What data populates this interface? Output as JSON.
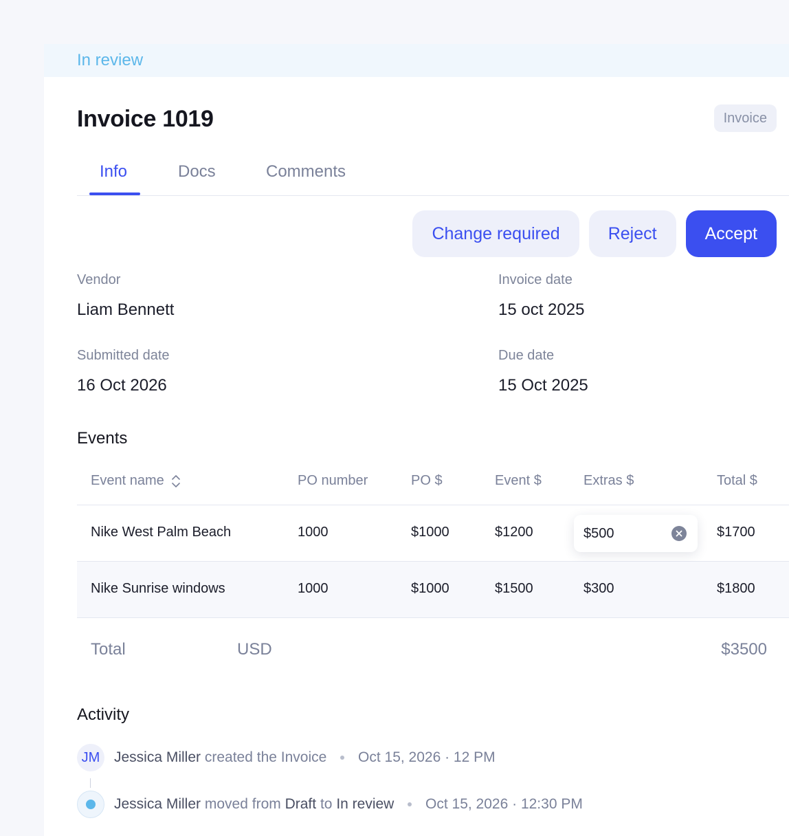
{
  "status": "In review",
  "header": {
    "title": "Invoice 1019",
    "badge": "Invoice"
  },
  "tabs": [
    {
      "label": "Info",
      "active": true
    },
    {
      "label": "Docs",
      "active": false
    },
    {
      "label": "Comments",
      "active": false
    }
  ],
  "actions": {
    "change_required": "Change required",
    "reject": "Reject",
    "accept": "Accept"
  },
  "fields": {
    "vendor": {
      "label": "Vendor",
      "value": "Liam Bennett"
    },
    "invoice_date": {
      "label": "Invoice date",
      "value": "15 oct 2025"
    },
    "submitted_date": {
      "label": "Submitted date",
      "value": "16 Oct 2026"
    },
    "due_date": {
      "label": "Due date",
      "value": "15 Oct 2025"
    }
  },
  "events": {
    "title": "Events",
    "columns": [
      "Event name",
      "PO number",
      "PO $",
      "Event $",
      "Extras $",
      "Total $"
    ],
    "rows": [
      {
        "name": "Nike West Palm Beach",
        "po_number": "1000",
        "po": "$1000",
        "event": "$1200",
        "extras": "$500",
        "total": "$1700"
      },
      {
        "name": "Nike Sunrise windows",
        "po_number": "1000",
        "po": "$1000",
        "event": "$1500",
        "extras": "$300",
        "total": "$1800"
      }
    ],
    "total": {
      "label": "Total",
      "currency": "USD",
      "amount": "$3500"
    }
  },
  "activity": {
    "title": "Activity",
    "items": [
      {
        "avatar": "JM",
        "actor": "Jessica Miller",
        "text": "created the Invoice",
        "time": "Oct 15, 2026 · 12 PM"
      },
      {
        "actor": "Jessica Miller",
        "text_1": "moved from",
        "from": "Draft",
        "text_2": "to",
        "to": "In review",
        "time": "Oct 15, 2026 · 12:30 PM"
      }
    ]
  },
  "colors": {
    "accent": "#3b4ff0",
    "status": "#5cb7ea",
    "muted": "#7a8199"
  }
}
